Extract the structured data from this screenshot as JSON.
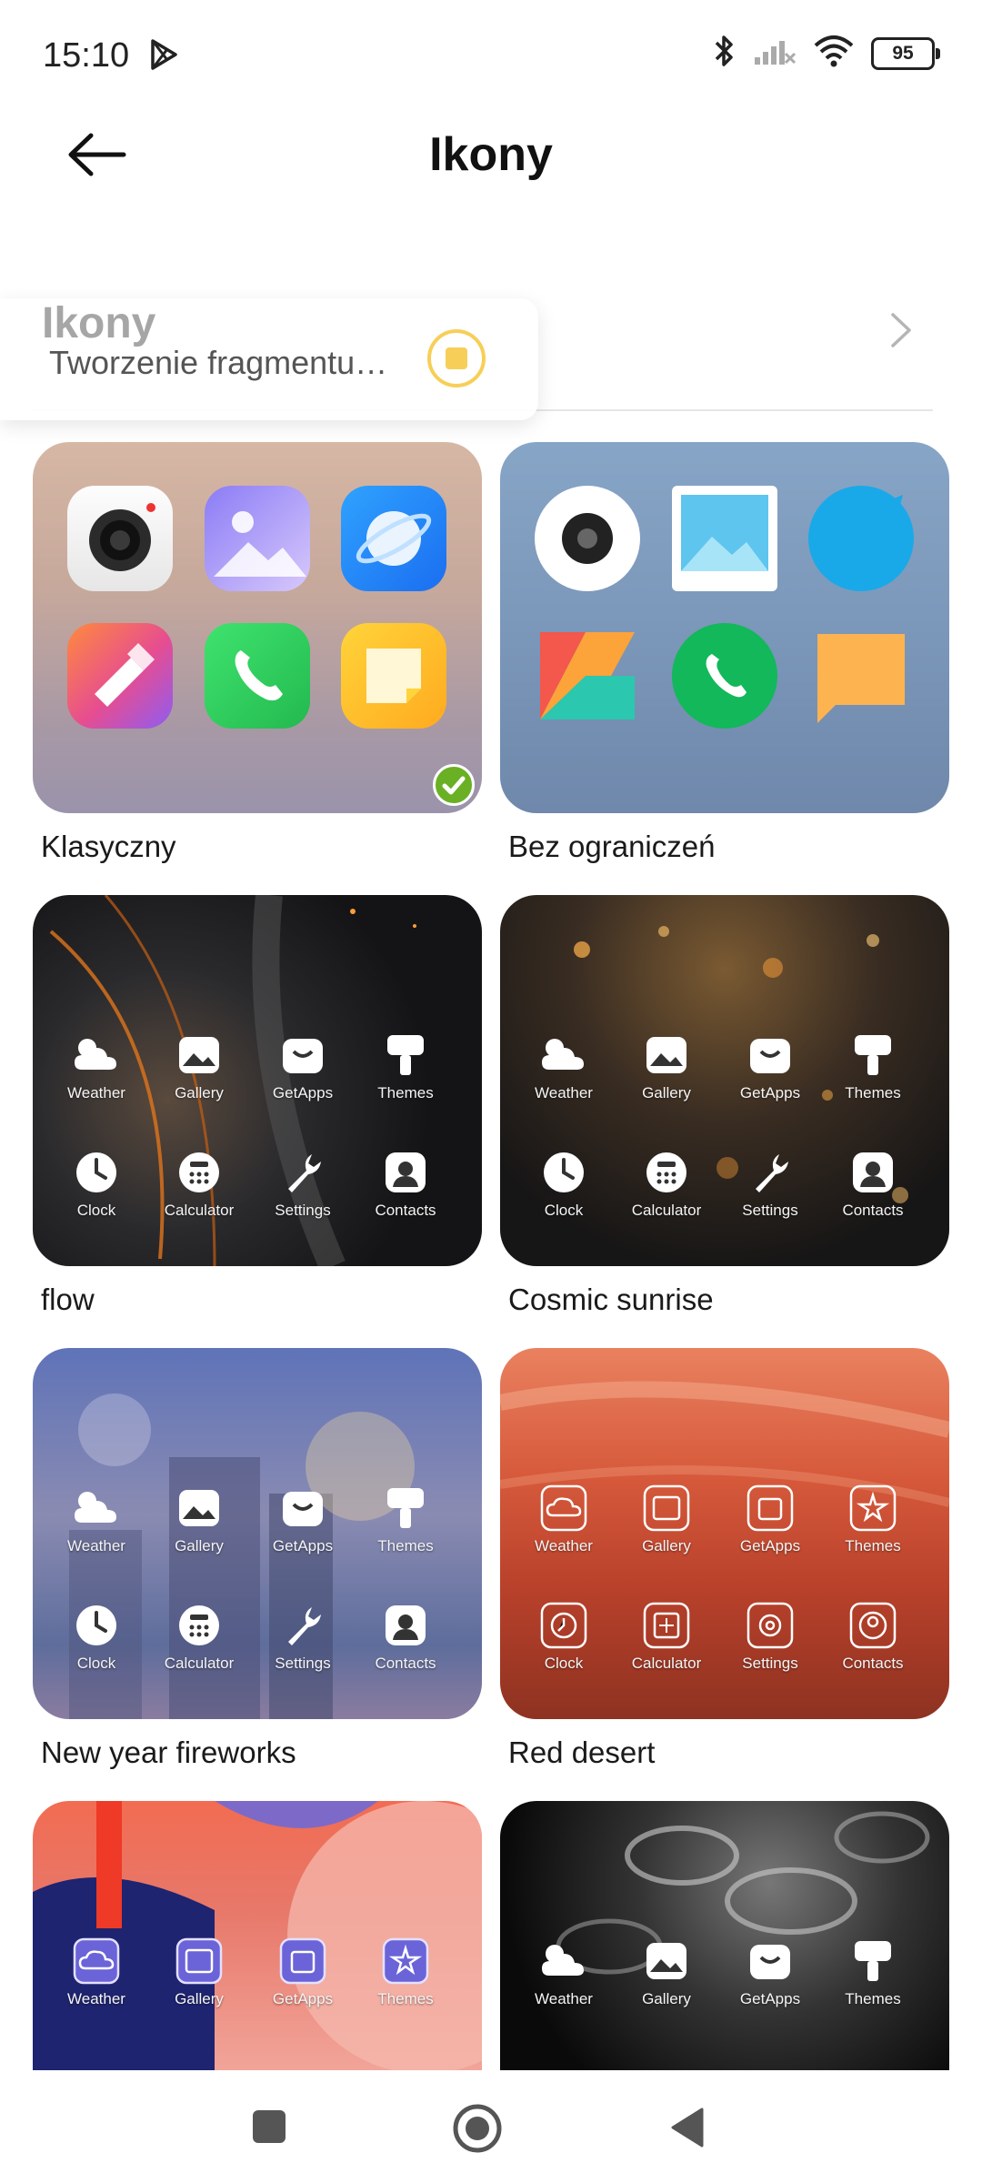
{
  "status": {
    "time": "15:10",
    "battery": "95"
  },
  "header": {
    "title": "Ikony"
  },
  "capture_toast": {
    "title": "Ikony",
    "subtitle": "Tworzenie fragmentu…"
  },
  "themes": [
    {
      "name": "Klasyczny",
      "selected": true
    },
    {
      "name": "Bez ograniczeń"
    },
    {
      "name": "flow"
    },
    {
      "name": "Cosmic sunrise"
    },
    {
      "name": "New year fireworks"
    },
    {
      "name": "Red desert"
    },
    {
      "name": "",
      "partial": true
    },
    {
      "name": "",
      "partial": true
    }
  ],
  "preview_labels": [
    "Weather",
    "Gallery",
    "GetApps",
    "Themes",
    "Clock",
    "Calculator",
    "Settings",
    "Contacts"
  ],
  "colors": {
    "selected_check": "#6ab024",
    "record_accent": "#f7cf58"
  }
}
